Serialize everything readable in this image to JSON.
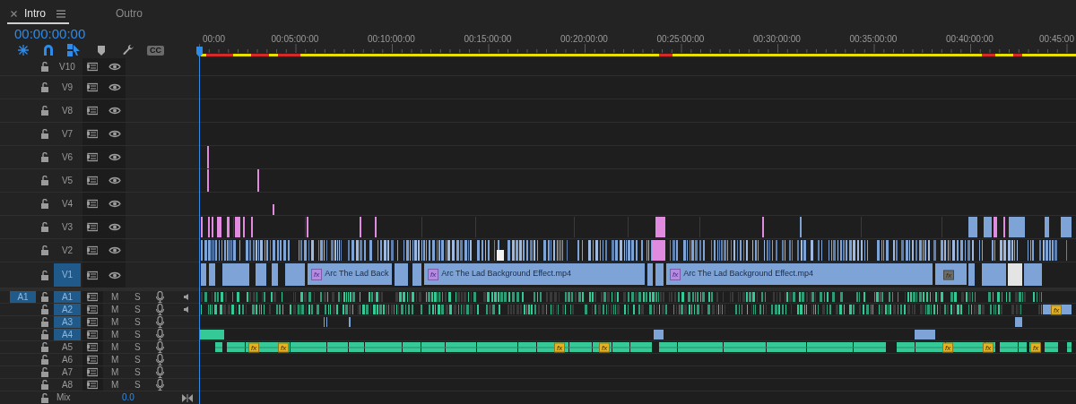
{
  "sequence_tabs": [
    {
      "label": "Intro",
      "selected": true
    },
    {
      "label": "Outro",
      "selected": false
    }
  ],
  "timecode": "00:00:00:00",
  "toolbar": [
    {
      "kind": "nest",
      "on": true
    },
    {
      "kind": "snap",
      "on": true
    },
    {
      "kind": "linked",
      "on": true
    },
    {
      "kind": "marker",
      "on": false
    },
    {
      "kind": "settings",
      "on": false
    },
    {
      "kind": "captions",
      "on": false,
      "label": "CC"
    }
  ],
  "ruler": [
    "00:00",
    "00:05:00:00",
    "00:10:00:00",
    "00:15:00:00",
    "00:20:00:00",
    "00:25:00:00",
    "00:30:00:00",
    "00:35:00:00",
    "00:40:00:00",
    "00:45:00"
  ],
  "video_tracks": [
    {
      "name": "V10",
      "targeted": false
    },
    {
      "name": "V9",
      "targeted": false
    },
    {
      "name": "V8",
      "targeted": false
    },
    {
      "name": "V7",
      "targeted": false
    },
    {
      "name": "V6",
      "targeted": false
    },
    {
      "name": "V5",
      "targeted": false
    },
    {
      "name": "V4",
      "targeted": false
    },
    {
      "name": "V3",
      "targeted": false
    },
    {
      "name": "V2",
      "targeted": false
    },
    {
      "name": "V1",
      "targeted": true,
      "clips": [
        {
          "label": "Arc The Lad Back",
          "fx": "fx"
        },
        {
          "label": "Arc The Lad Background Effect.mp4",
          "fx": "fx"
        },
        {
          "label": "Arc The Lad Background Effect.mp4",
          "fx": "fx"
        }
      ],
      "fx_badges": [
        {
          "label": "fx",
          "color": "#6b6b6b"
        }
      ]
    }
  ],
  "audio_tracks": [
    {
      "name": "A1",
      "targeted": true,
      "mute": "M",
      "solo": "S",
      "meter": true,
      "source_patch": "A1"
    },
    {
      "name": "A2",
      "targeted": true,
      "mute": "M",
      "solo": "S",
      "meter": true,
      "fx_badges": [
        {
          "label": "fx",
          "color": "#e5b322"
        }
      ]
    },
    {
      "name": "A3",
      "targeted": true,
      "mute": "M",
      "solo": "S",
      "meter": false
    },
    {
      "name": "A4",
      "targeted": true,
      "mute": "M",
      "solo": "S",
      "meter": false
    },
    {
      "name": "A5",
      "targeted": false,
      "mute": "M",
      "solo": "S",
      "meter": false,
      "fx_badges": [
        {
          "label": "fx",
          "color": "#e5b322"
        },
        {
          "label": "fx",
          "color": "#e5b322"
        },
        {
          "label": "fx",
          "color": "#e5b322"
        },
        {
          "label": "fx",
          "color": "#e5b322"
        },
        {
          "label": "fx",
          "color": "#e5b322"
        },
        {
          "label": "fx",
          "color": "#e5b322"
        },
        {
          "label": "fx",
          "color": "#e5b322"
        }
      ]
    },
    {
      "name": "A6",
      "targeted": false,
      "mute": "M",
      "solo": "S",
      "meter": false
    },
    {
      "name": "A7",
      "targeted": false,
      "mute": "M",
      "solo": "S",
      "meter": false
    },
    {
      "name": "A8",
      "targeted": false,
      "mute": "M",
      "solo": "S",
      "meter": false
    }
  ],
  "mix": {
    "label": "Mix",
    "value": "0.0"
  }
}
